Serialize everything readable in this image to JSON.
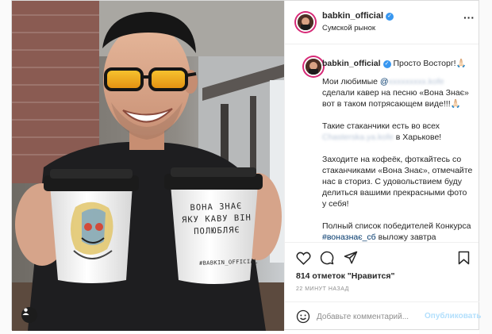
{
  "post": {
    "username": "babkin_official",
    "location": "Сумской рынок",
    "photo": {
      "cup_left_text": "",
      "cup_right_caption": "ВОНА ЗНАЄ ЯКУ КАВУ ВІН ПОЛЮБЛЯЄ",
      "cup_right_handle": "#BABKIN_OFFICIAL"
    }
  },
  "caption": {
    "username": "babkin_official",
    "headline": "Просто Восторг!🙏🏻",
    "p1_start": "Мои любимые ",
    "p1_mention": "@",
    "p1_mention_blur": "xxxxxxxxx.kofe",
    "p1_rest": " сделали кавер на песню «Вона Знає» вот в таком потрясающем виде!!!🙏🏻",
    "p2_start": "Такие стаканчики есть во всех ",
    "p2_blur": "Chasterska.ya.kofe",
    "p2_rest": " в Харькове!",
    "p3": "Заходите на кофеёк, фоткайтесь со стаканчиками «Вона Знає», отмечайте нас в сториз. С удовольствием буду делиться вашими прекрасными фото у себя!",
    "p4_start": "Полный список победителей Конкурса ",
    "p4_hashtag": "#вонaзнає_сб",
    "p4_rest": " выложу завтра вечером!🙏🏻 Ждите!🙏🏻"
  },
  "actions": {
    "likes": "814 отметок \"Нравится\"",
    "time": "22 МИНУТ НАЗАД"
  },
  "comment_box": {
    "placeholder": "Добавьте комментарий...",
    "publish_label": "Опубликовать"
  },
  "icons": {
    "like": "heart-icon",
    "comment": "comment-icon",
    "share": "paper-plane-icon",
    "save": "bookmark-icon",
    "emoji": "emoji-icon",
    "more": "more-dots-icon",
    "verified": "verified-badge-icon",
    "tag": "user-tag-icon"
  },
  "colors": {
    "verified_blue": "#3897f0",
    "link": "#00376b",
    "publish_disabled": "#b2dffc",
    "muted": "#8e8e8e"
  }
}
